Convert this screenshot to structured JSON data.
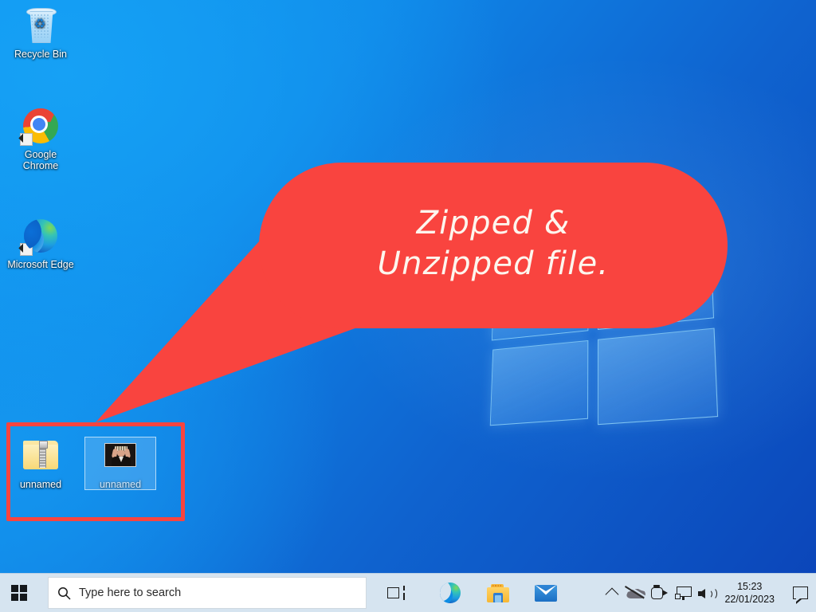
{
  "os": {
    "name": "Windows 10 Desktop",
    "theme": "light-taskbar",
    "wallpaper": "windows-10-hero-blue"
  },
  "colors": {
    "annotation_red": "#f9443f",
    "callout_text": "#fdf6ee",
    "wallpaper_light_blue": "#0e96ef",
    "wallpaper_dark_blue": "#0b44b8",
    "taskbar_bg": "#d6e4f0",
    "selection_blue": "#78bef5"
  },
  "desktop": {
    "icons": [
      {
        "name": "recycle-bin",
        "label": "Recycle Bin",
        "icon": "recycle-bin-icon",
        "selected": false,
        "shortcut": false
      },
      {
        "name": "google-chrome",
        "label": "Google\nChrome",
        "icon": "chrome-icon",
        "selected": false,
        "shortcut": true
      },
      {
        "name": "microsoft-edge",
        "label": "Microsoft\nEdge",
        "icon": "edge-icon",
        "selected": false,
        "shortcut": true
      },
      {
        "name": "zipped-file",
        "label": "unnamed",
        "icon": "zipped-folder-icon",
        "selected": false,
        "shortcut": false
      },
      {
        "name": "unzipped-file",
        "label": "unnamed",
        "icon": "image-file-icon",
        "selected": true,
        "shortcut": false
      }
    ]
  },
  "annotation": {
    "callout_text": "Zipped &\nUnzipped file.",
    "highlight_label": "zipped-and-unzipped-files-highlight"
  },
  "taskbar": {
    "start_label": "Start",
    "search": {
      "placeholder": "Type here to search",
      "value": ""
    },
    "buttons": [
      {
        "name": "task-view",
        "label": "Task View"
      },
      {
        "name": "microsoft-edge",
        "label": "Microsoft Edge"
      },
      {
        "name": "file-explorer",
        "label": "File Explorer"
      },
      {
        "name": "mail",
        "label": "Mail"
      }
    ],
    "tray": [
      {
        "name": "show-hidden-icons",
        "label": "Show hidden icons"
      },
      {
        "name": "onedrive",
        "label": "OneDrive"
      },
      {
        "name": "camera",
        "label": "Camera"
      },
      {
        "name": "network",
        "label": "Network"
      },
      {
        "name": "volume",
        "label": "Volume"
      }
    ],
    "clock": {
      "time": "15:23",
      "date": "22/01/2023"
    },
    "action_center_label": "Action Center"
  }
}
